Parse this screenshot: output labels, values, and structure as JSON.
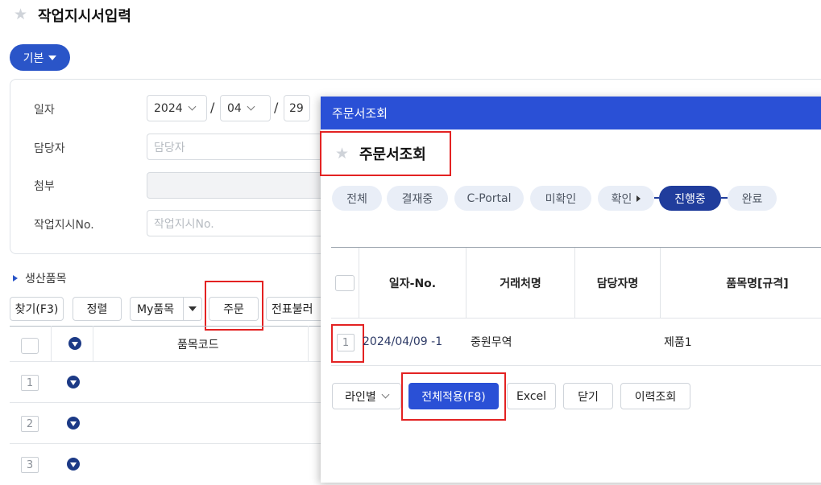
{
  "page": {
    "title": "작업지시서입력",
    "preset_label": "기본",
    "form": {
      "date_label": "일자",
      "date_year": "2024",
      "date_month": "04",
      "date_day": "29",
      "manager_label": "담당자",
      "manager_placeholder": "담당자",
      "attach_label": "첨부",
      "workorder_label": "작업지시No.",
      "workorder_placeholder": "작업지시No."
    },
    "section_title": "생산품목",
    "toolbar": {
      "find": "찾기(F3)",
      "sort": "정렬",
      "my_items": "My품목",
      "order": "주문",
      "load_slip": "전표불러"
    },
    "grid": {
      "col_item_code": "품목코드",
      "rows": [
        "1",
        "2",
        "3"
      ]
    }
  },
  "modal": {
    "header_title": "주문서조회",
    "title": "주문서조회",
    "status_tabs": [
      "전체",
      "결재중",
      "C-Portal",
      "미확인",
      "확인",
      "진행중",
      "완료"
    ],
    "active_tab": "진행중",
    "table": {
      "headers": [
        "일자-No.",
        "거래처명",
        "담당자명",
        "품목명[규격]"
      ],
      "rows": [
        {
          "num": "1",
          "date_no": "2024/04/09 -1",
          "customer": "중원무역",
          "manager": "",
          "item": "제품1"
        }
      ]
    },
    "footer": {
      "line_select": "라인별",
      "apply_all": "전체적용(F8)",
      "excel": "Excel",
      "close": "닫기",
      "history": "이력조회"
    }
  },
  "colors": {
    "accent": "#2a50d6",
    "active_tab": "#203d9c",
    "highlight": "#e32222"
  }
}
